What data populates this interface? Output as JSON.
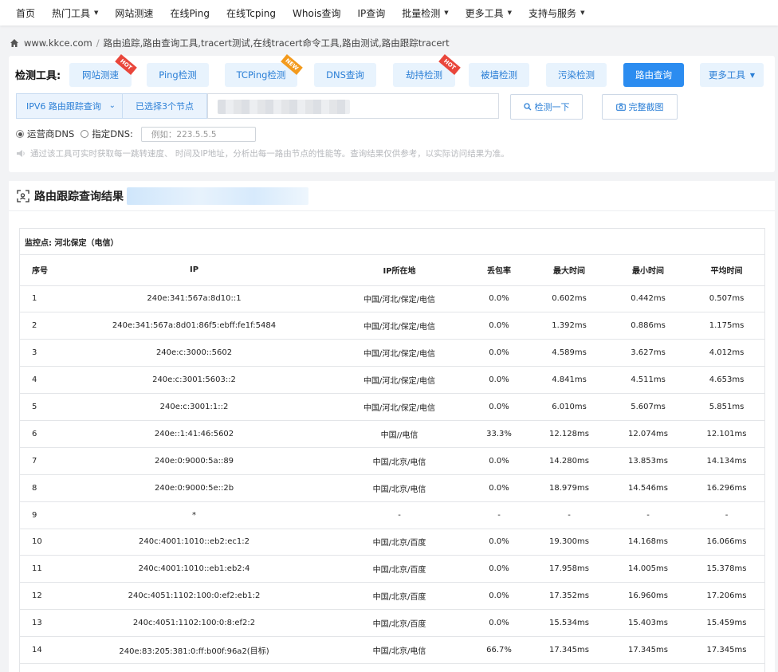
{
  "nav": [
    {
      "label": "首页",
      "dropdown": false
    },
    {
      "label": "热门工具",
      "dropdown": true
    },
    {
      "label": "网站测速",
      "dropdown": false
    },
    {
      "label": "在线Ping",
      "dropdown": false
    },
    {
      "label": "在线Tcping",
      "dropdown": false
    },
    {
      "label": "Whois查询",
      "dropdown": false
    },
    {
      "label": "IP查询",
      "dropdown": false
    },
    {
      "label": "批量检测",
      "dropdown": true
    },
    {
      "label": "更多工具",
      "dropdown": true
    },
    {
      "label": "支持与服务",
      "dropdown": true
    }
  ],
  "breadcrumb": {
    "site": "www.kkce.com",
    "separator": "/",
    "page": "路由追踪,路由查询工具,tracert测试,在线tracert命令工具,路由测试,路由跟踪tracert"
  },
  "tools": {
    "label": "检测工具:",
    "buttons": [
      {
        "label": "网站测速",
        "badge": "HOT"
      },
      {
        "label": "Ping检测",
        "badge": ""
      },
      {
        "label": "TCPing检测",
        "badge": "NEW"
      },
      {
        "label": "DNS查询",
        "badge": ""
      },
      {
        "label": "劫持检测",
        "badge": "HOT"
      },
      {
        "label": "被墙检测",
        "badge": ""
      },
      {
        "label": "污染检测",
        "badge": ""
      },
      {
        "label": "路由查询",
        "badge": "",
        "active": true
      },
      {
        "label": "更多工具",
        "badge": ""
      }
    ],
    "query_type": "IPV6 路由跟踪查询",
    "nodes_selected": "已选择3个节点",
    "check_button": "检测一下",
    "screenshot_button": "完整截图",
    "dns_option_isp": "运营商DNS",
    "dns_option_custom": "指定DNS:",
    "dns_placeholder": "例如：223.5.5.5",
    "notice": "通过该工具可实时获取每一跳转速度、 时间及IP地址，分析出每一路由节点的性能等。查询结果仅供参考，以实际访问结果为准。"
  },
  "result": {
    "title": "路由跟踪查询结果",
    "monitor": "监控点: 河北保定（电信）",
    "columns": [
      "序号",
      "IP",
      "IP所在地",
      "丢包率",
      "最大时间",
      "最小时间",
      "平均时间"
    ],
    "rows": [
      [
        "1",
        "240e:341:567a:8d10::1",
        "中国/河北/保定/电信",
        "0.0%",
        "0.602ms",
        "0.442ms",
        "0.507ms"
      ],
      [
        "2",
        "240e:341:567a:8d01:86f5:ebff:fe1f:5484",
        "中国/河北/保定/电信",
        "0.0%",
        "1.392ms",
        "0.886ms",
        "1.175ms"
      ],
      [
        "3",
        "240e:c:3000::5602",
        "中国/河北/保定/电信",
        "0.0%",
        "4.589ms",
        "3.627ms",
        "4.012ms"
      ],
      [
        "4",
        "240e:c:3001:5603::2",
        "中国/河北/保定/电信",
        "0.0%",
        "4.841ms",
        "4.511ms",
        "4.653ms"
      ],
      [
        "5",
        "240e:c:3001:1::2",
        "中国/河北/保定/电信",
        "0.0%",
        "6.010ms",
        "5.607ms",
        "5.851ms"
      ],
      [
        "6",
        "240e::1:41:46:5602",
        "中国//电信",
        "33.3%",
        "12.128ms",
        "12.074ms",
        "12.101ms"
      ],
      [
        "7",
        "240e:0:9000:5a::89",
        "中国/北京/电信",
        "0.0%",
        "14.280ms",
        "13.853ms",
        "14.134ms"
      ],
      [
        "8",
        "240e:0:9000:5e::2b",
        "中国/北京/电信",
        "0.0%",
        "18.979ms",
        "14.546ms",
        "16.296ms"
      ],
      [
        "9",
        "*",
        "-",
        "-",
        "-",
        "-",
        "-"
      ],
      [
        "10",
        "240c:4001:1010::eb2:ec1:2",
        "中国/北京/百度",
        "0.0%",
        "19.300ms",
        "14.168ms",
        "16.066ms"
      ],
      [
        "11",
        "240c:4001:1010::eb1:eb2:4",
        "中国/北京/百度",
        "0.0%",
        "17.958ms",
        "14.005ms",
        "15.378ms"
      ],
      [
        "12",
        "240c:4051:1102:100:0:ef2:eb1:2",
        "中国/北京/百度",
        "0.0%",
        "17.352ms",
        "16.960ms",
        "17.206ms"
      ],
      [
        "13",
        "240c:4051:1102:100:0:8:ef2:2",
        "中国/北京/百度",
        "0.0%",
        "15.534ms",
        "15.403ms",
        "15.459ms"
      ],
      [
        "14",
        "240e:83:205:381:0:ff:b00f:96a2(目标)",
        "中国/北京/电信",
        "66.7%",
        "17.345ms",
        "17.345ms",
        "17.345ms"
      ]
    ]
  },
  "colors": {
    "accent": "#2b8cf0",
    "accent_light": "#e8f3fd",
    "hot": "#e9463b",
    "new": "#f39a1c"
  }
}
